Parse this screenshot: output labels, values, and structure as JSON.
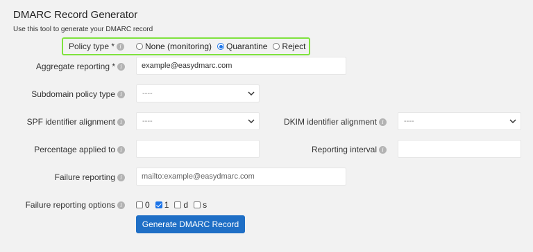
{
  "header": {
    "title": "DMARC Record Generator",
    "subtitle": "Use this tool to generate your DMARC record"
  },
  "policy": {
    "label": "Policy type *",
    "options": [
      "None (monitoring)",
      "Quarantine",
      "Reject"
    ],
    "selected": "Quarantine"
  },
  "aggregate": {
    "label": "Aggregate reporting *",
    "value": "example@easydmarc.com"
  },
  "subdomain": {
    "label": "Subdomain policy type",
    "value": "----"
  },
  "spf": {
    "label": "SPF identifier alignment",
    "value": "----"
  },
  "dkim": {
    "label": "DKIM identifier alignment",
    "value": "----"
  },
  "percentage": {
    "label": "Percentage applied to",
    "value": ""
  },
  "interval": {
    "label": "Reporting interval",
    "value": ""
  },
  "failure": {
    "label": "Failure reporting",
    "placeholder": "mailto:example@easydmarc.com"
  },
  "failure_options": {
    "label": "Failure reporting options",
    "options": [
      "0",
      "1",
      "d",
      "s"
    ],
    "checked": [
      "1"
    ]
  },
  "generate_button": "Generate DMARC Record",
  "colors": {
    "accent": "#1f6fc6",
    "highlight": "#7fe23e",
    "background": "#f2f2f2"
  }
}
